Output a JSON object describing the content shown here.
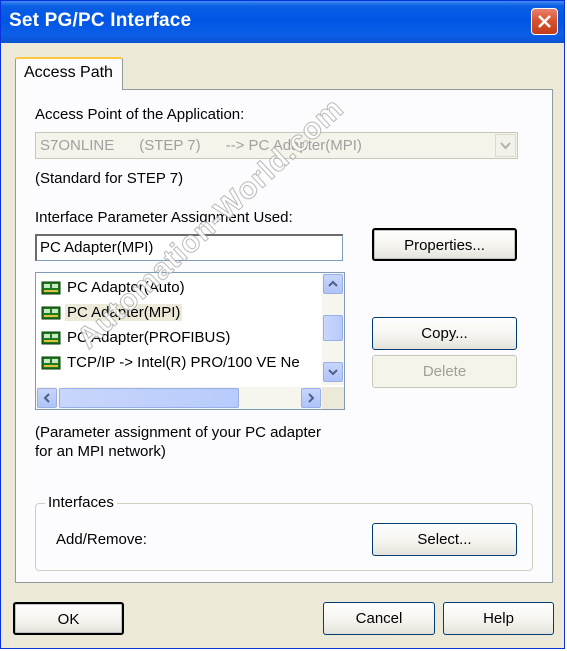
{
  "window": {
    "title": "Set PG/PC Interface"
  },
  "tabs": [
    {
      "label": "Access Path"
    }
  ],
  "access_point": {
    "label": "Access Point of the Application:",
    "value": "S7ONLINE      (STEP 7)      --> PC Adapter(MPI)",
    "note": "(Standard for STEP 7)"
  },
  "interface_param": {
    "label": "Interface Parameter Assignment Used:",
    "value": "PC Adapter(MPI)",
    "properties_button": "Properties..."
  },
  "list": {
    "items": [
      {
        "label": "PC Adapter(Auto)"
      },
      {
        "label": "PC Adapter(MPI)",
        "selected": true
      },
      {
        "label": "PC Adapter(PROFIBUS)"
      },
      {
        "label": "TCP/IP -> Intel(R) PRO/100 VE Ne"
      }
    ]
  },
  "buttons": {
    "copy": "Copy...",
    "delete": "Delete",
    "ok": "OK",
    "cancel": "Cancel",
    "help": "Help"
  },
  "description": {
    "line1": "(Parameter assignment of your PC adapter",
    "line2": "for an MPI network)"
  },
  "interfaces": {
    "legend": "Interfaces",
    "add_remove_label": "Add/Remove:",
    "select_button": "Select..."
  },
  "watermark": "Automation-World.com",
  "colors": {
    "titlebar": "#0055e5",
    "face": "#ece9d8",
    "panel": "#fcfcfe",
    "tab_highlight": "#ffc83c",
    "close": "#d8532f"
  }
}
